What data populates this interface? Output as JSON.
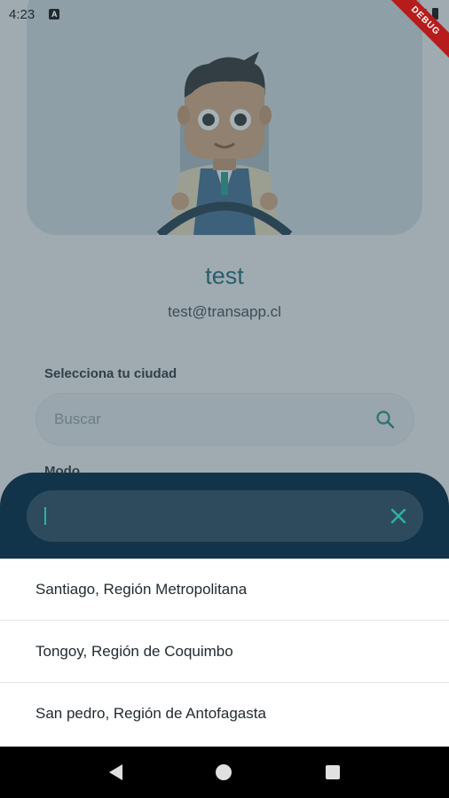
{
  "status_bar": {
    "time": "4:23",
    "notification_badge": "A",
    "debug_label": "DEBUG"
  },
  "profile": {
    "name": "test",
    "email": "test@transapp.cl"
  },
  "form": {
    "city_label": "Selecciona tu ciudad",
    "search_placeholder": "Buscar",
    "mode_label": "Modo"
  },
  "sheet": {
    "input_value": "",
    "results": [
      {
        "label": "Santiago, Región Metropolitana"
      },
      {
        "label": "Tongoy, Región de Coquimbo"
      },
      {
        "label": "San pedro, Región de Antofagasta"
      }
    ]
  },
  "colors": {
    "accent": "#2bb3a3",
    "sheet_bg": "#12344a",
    "name_color": "#176a78"
  },
  "icons": {
    "search": "search-icon",
    "clear": "close-icon",
    "back": "back-triangle-icon",
    "home": "home-circle-icon",
    "recents": "recents-square-icon"
  }
}
